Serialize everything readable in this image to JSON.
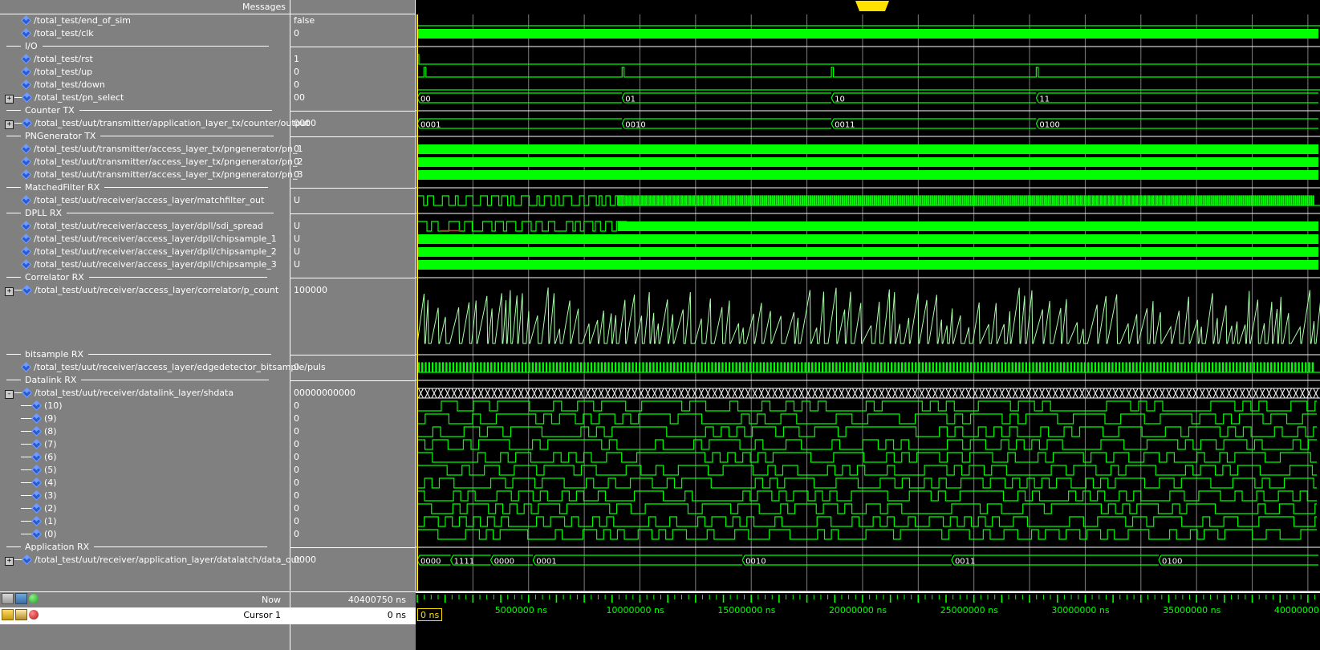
{
  "window": {
    "messages_header": "Messages",
    "background": "#808080",
    "wave_background": "#000000",
    "signal_color": "#00ff00",
    "cursor_color": "#ffe100"
  },
  "signals": [
    {
      "type": "signal",
      "indent": 0,
      "expand": "",
      "name": "/total_test/end_of_sim",
      "value": "false",
      "wave": "flat0"
    },
    {
      "type": "signal",
      "indent": 0,
      "expand": "",
      "name": "/total_test/clk",
      "value": "0",
      "wave": "solidhigh"
    },
    {
      "type": "group",
      "name": "I/O"
    },
    {
      "type": "signal",
      "indent": 0,
      "expand": "",
      "name": "/total_test/rst",
      "value": "1",
      "wave": "rstpulse"
    },
    {
      "type": "signal",
      "indent": 0,
      "expand": "",
      "name": "/total_test/up",
      "value": "0",
      "wave": "uppulses"
    },
    {
      "type": "signal",
      "indent": 0,
      "expand": "",
      "name": "/total_test/down",
      "value": "0",
      "wave": "flat0"
    },
    {
      "type": "bus",
      "indent": 0,
      "expand": "+",
      "name": "/total_test/pn_select",
      "value": "00",
      "wave": "bus_pnsel"
    },
    {
      "type": "group",
      "name": "Counter TX"
    },
    {
      "type": "bus",
      "indent": 0,
      "expand": "+",
      "name": "/total_test/uut/transmitter/application_layer_tx/counter/output",
      "value": "0000",
      "wave": "bus_counter"
    },
    {
      "type": "group",
      "name": "PNGenerator TX"
    },
    {
      "type": "signal",
      "indent": 0,
      "expand": "",
      "name": "/total_test/uut/transmitter/access_layer_tx/pngenerator/pn_1",
      "value": "0",
      "wave": "solidhigh"
    },
    {
      "type": "signal",
      "indent": 0,
      "expand": "",
      "name": "/total_test/uut/transmitter/access_layer_tx/pngenerator/pn_2",
      "value": "0",
      "wave": "solidhigh"
    },
    {
      "type": "signal",
      "indent": 0,
      "expand": "",
      "name": "/total_test/uut/transmitter/access_layer_tx/pngenerator/pn_3",
      "value": "0",
      "wave": "solidhigh"
    },
    {
      "type": "group",
      "name": "MatchedFilter RX"
    },
    {
      "type": "signal",
      "indent": 0,
      "expand": "",
      "name": "/total_test/uut/receiver/access_layer/matchfilter_out",
      "value": "U",
      "wave": "dense_then_solid"
    },
    {
      "type": "group",
      "name": "DPLL RX"
    },
    {
      "type": "signal",
      "indent": 0,
      "expand": "",
      "name": "/total_test/uut/receiver/access_layer/dpll/sdi_spread",
      "value": "U",
      "wave": "sdi"
    },
    {
      "type": "signal",
      "indent": 0,
      "expand": "",
      "name": "/total_test/uut/receiver/access_layer/dpll/chipsample_1",
      "value": "U",
      "wave": "solidhigh"
    },
    {
      "type": "signal",
      "indent": 0,
      "expand": "",
      "name": "/total_test/uut/receiver/access_layer/dpll/chipsample_2",
      "value": "U",
      "wave": "solidhigh"
    },
    {
      "type": "signal",
      "indent": 0,
      "expand": "",
      "name": "/total_test/uut/receiver/access_layer/dpll/chipsample_3",
      "value": "U",
      "wave": "solidhigh"
    },
    {
      "type": "group",
      "name": "Correlator RX"
    },
    {
      "type": "analog",
      "indent": 0,
      "expand": "+",
      "name": "/total_test/uut/receiver/access_layer/correlator/p_count",
      "value": "100000",
      "wave": "analog_sawtooth"
    },
    {
      "type": "group",
      "name": "bitsample RX"
    },
    {
      "type": "signal",
      "indent": 0,
      "expand": "",
      "name": "/total_test/uut/receiver/access_layer/edgedetector_bitsample/puls",
      "value": "0",
      "wave": "pulsetrain"
    },
    {
      "type": "group",
      "name": "Datalink RX"
    },
    {
      "type": "bus",
      "indent": 0,
      "expand": "-",
      "name": "/total_test/uut/receiver/datalink_layer/shdata",
      "value": "00000000000",
      "wave": "bus_fast"
    },
    {
      "type": "bit",
      "indent": 1,
      "expand": "",
      "name": "(10)",
      "value": "0",
      "wave": "sh10"
    },
    {
      "type": "bit",
      "indent": 1,
      "expand": "",
      "name": "(9)",
      "value": "0",
      "wave": "sh9"
    },
    {
      "type": "bit",
      "indent": 1,
      "expand": "",
      "name": "(8)",
      "value": "0",
      "wave": "sh8"
    },
    {
      "type": "bit",
      "indent": 1,
      "expand": "",
      "name": "(7)",
      "value": "0",
      "wave": "sh7"
    },
    {
      "type": "bit",
      "indent": 1,
      "expand": "",
      "name": "(6)",
      "value": "0",
      "wave": "sh6"
    },
    {
      "type": "bit",
      "indent": 1,
      "expand": "",
      "name": "(5)",
      "value": "0",
      "wave": "sh5"
    },
    {
      "type": "bit",
      "indent": 1,
      "expand": "",
      "name": "(4)",
      "value": "0",
      "wave": "sh4"
    },
    {
      "type": "bit",
      "indent": 1,
      "expand": "",
      "name": "(3)",
      "value": "0",
      "wave": "sh3"
    },
    {
      "type": "bit",
      "indent": 1,
      "expand": "",
      "name": "(2)",
      "value": "0",
      "wave": "sh2"
    },
    {
      "type": "bit",
      "indent": 1,
      "expand": "",
      "name": "(1)",
      "value": "0",
      "wave": "sh1"
    },
    {
      "type": "bit",
      "indent": 1,
      "expand": "",
      "name": "(0)",
      "value": "0",
      "wave": "sh0"
    },
    {
      "type": "group",
      "name": "Application RX"
    },
    {
      "type": "bus",
      "indent": 0,
      "expand": "+",
      "name": "/total_test/uut/receiver/application_layer/datalatch/data_out",
      "value": "0000",
      "wave": "bus_dataout"
    }
  ],
  "bus_transitions": {
    "pn_select": [
      {
        "t": 0,
        "label": "00"
      },
      {
        "t": 9.2,
        "label": "01"
      },
      {
        "t": 18.6,
        "label": "10"
      },
      {
        "t": 27.8,
        "label": "11"
      }
    ],
    "counter_output": [
      {
        "t": 0,
        "label": "0001"
      },
      {
        "t": 9.2,
        "label": "0010"
      },
      {
        "t": 18.6,
        "label": "0011"
      },
      {
        "t": 27.8,
        "label": "0100"
      }
    ],
    "data_out": [
      {
        "t": 0,
        "label": "0000"
      },
      {
        "t": 1.5,
        "label": "1111"
      },
      {
        "t": 3.3,
        "label": "0000"
      },
      {
        "t": 5.2,
        "label": "0001"
      },
      {
        "t": 14.6,
        "label": "0010"
      },
      {
        "t": 24.0,
        "label": "0011"
      },
      {
        "t": 33.3,
        "label": "0100"
      }
    ]
  },
  "timeline": {
    "unit": "ns",
    "start": 0,
    "end": 40400750,
    "ticks": [
      {
        "value": 5000000,
        "label": "5000000 ns"
      },
      {
        "value": 10000000,
        "label": "10000000 ns"
      },
      {
        "value": 15000000,
        "label": "15000000 ns"
      },
      {
        "value": 20000000,
        "label": "20000000 ns"
      },
      {
        "value": 25000000,
        "label": "25000000 ns"
      },
      {
        "value": 30000000,
        "label": "30000000 ns"
      },
      {
        "value": 35000000,
        "label": "35000000 ns"
      },
      {
        "value": 40000000,
        "label": "40000000"
      }
    ],
    "origin_label": "ns"
  },
  "status": {
    "now_label": "Now",
    "now_value": "40400750 ns",
    "cursor_label": "Cursor 1",
    "cursor_value": "0 ns",
    "cursor_marker_label": "0 ns"
  }
}
